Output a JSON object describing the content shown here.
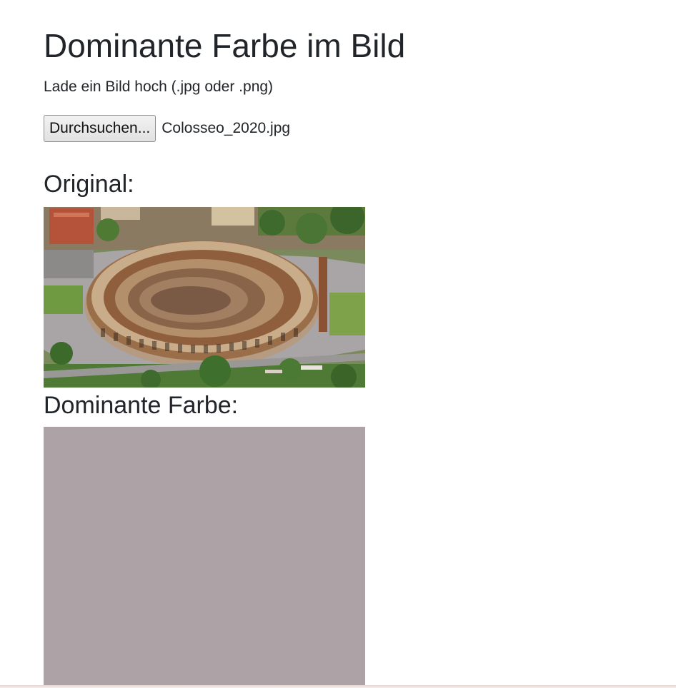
{
  "page": {
    "title": "Dominante Farbe im Bild",
    "instruction": "Lade ein Bild hoch (.jpg oder .png)"
  },
  "upload": {
    "button_label": "Durchsuchen...",
    "file_name": "Colosseo_2020.jpg"
  },
  "original": {
    "heading": "Original:",
    "image_subject": "aerial photo of the Colosseum in Rome"
  },
  "dominant": {
    "heading": "Dominante Farbe:",
    "color": "#ada3a6"
  }
}
